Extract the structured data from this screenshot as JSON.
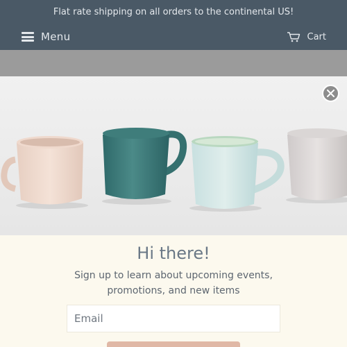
{
  "announcement": {
    "text": "Flat rate shipping on all orders to the continental US!"
  },
  "nav": {
    "menu_label": "Menu",
    "menu_icon": "hamburger-icon",
    "cart_label": "Cart",
    "cart_icon": "cart-icon"
  },
  "popup": {
    "close_icon": "close-icon",
    "title": "Hi there!",
    "description": "Sign up to learn about upcoming events, promotions, and new items",
    "email_placeholder": "Email",
    "submit_label": ""
  },
  "colors": {
    "header_bg": "#4a5966",
    "popup_bg": "#fcf9ee",
    "title_color": "#6a7886",
    "button_bg": "#e0b8a6"
  }
}
